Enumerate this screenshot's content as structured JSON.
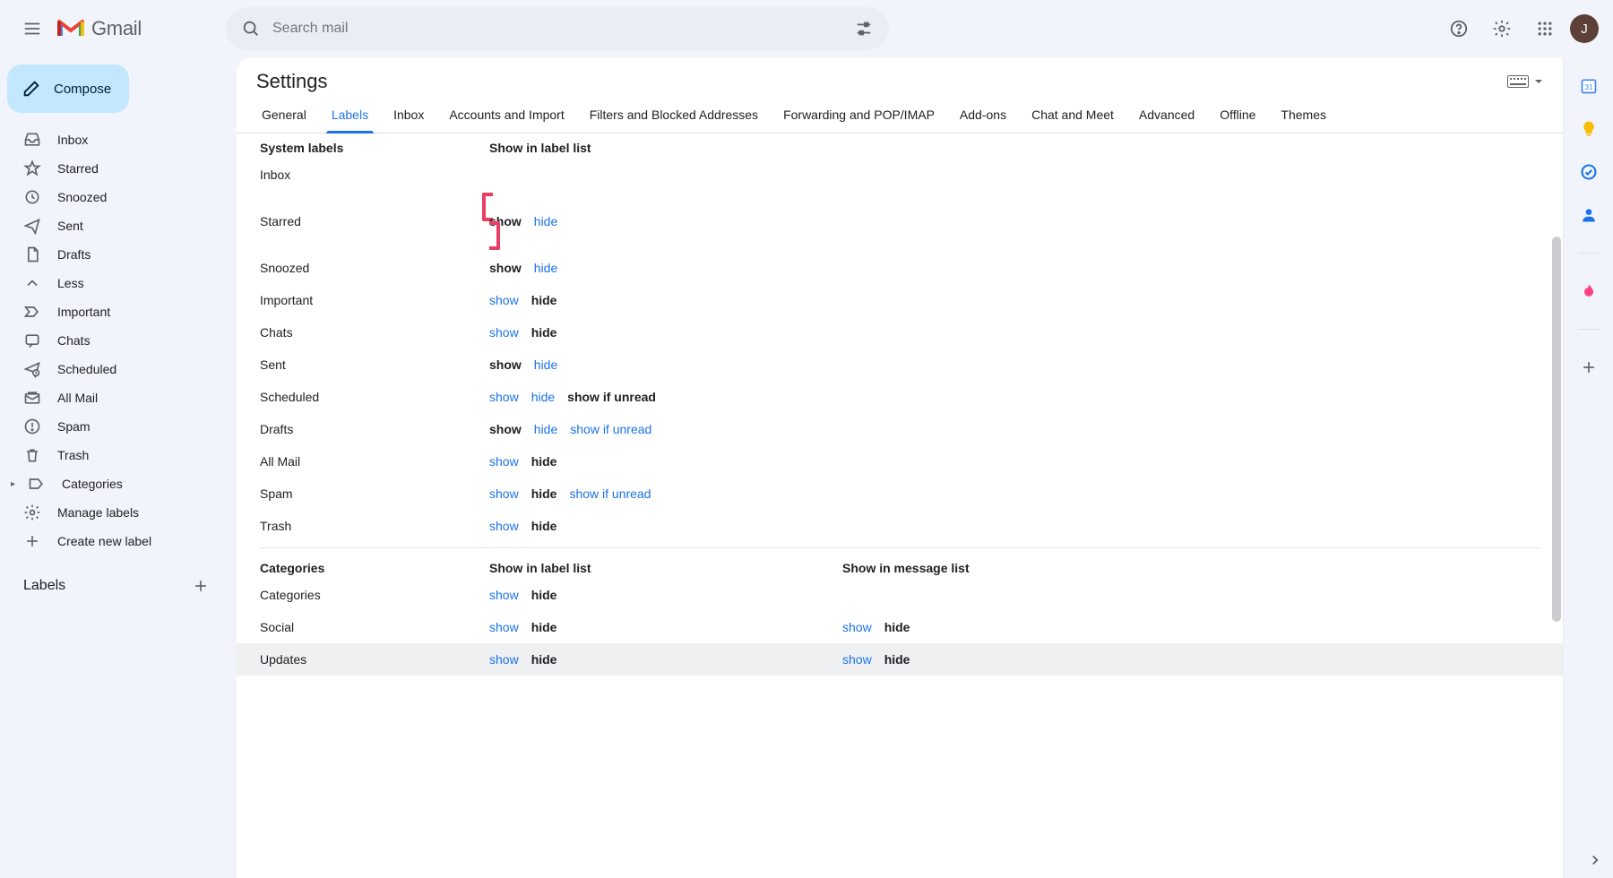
{
  "app_name": "Gmail",
  "search_placeholder": "Search mail",
  "avatar_letter": "J",
  "compose_label": "Compose",
  "sidebar": {
    "items": [
      {
        "label": "Inbox",
        "icon": "inbox-icon"
      },
      {
        "label": "Starred",
        "icon": "star-icon"
      },
      {
        "label": "Snoozed",
        "icon": "clock-icon"
      },
      {
        "label": "Sent",
        "icon": "send-icon"
      },
      {
        "label": "Drafts",
        "icon": "file-icon"
      },
      {
        "label": "Less",
        "icon": "chevron-up-icon"
      },
      {
        "label": "Important",
        "icon": "important-icon"
      },
      {
        "label": "Chats",
        "icon": "chat-icon"
      },
      {
        "label": "Scheduled",
        "icon": "scheduled-icon"
      },
      {
        "label": "All Mail",
        "icon": "allmail-icon"
      },
      {
        "label": "Spam",
        "icon": "spam-icon"
      },
      {
        "label": "Trash",
        "icon": "trash-icon"
      },
      {
        "label": "Categories",
        "icon": "tag-icon"
      },
      {
        "label": "Manage labels",
        "icon": "gear-icon"
      },
      {
        "label": "Create new label",
        "icon": "plus-icon"
      }
    ],
    "labels_heading": "Labels"
  },
  "settings": {
    "title": "Settings",
    "tabs": [
      "General",
      "Labels",
      "Inbox",
      "Accounts and Import",
      "Filters and Blocked Addresses",
      "Forwarding and POP/IMAP",
      "Add-ons",
      "Chat and Meet",
      "Advanced",
      "Offline",
      "Themes"
    ],
    "active_tab": "Labels",
    "section1": {
      "heading": "System labels",
      "col_heading": "Show in label list",
      "rows": [
        {
          "name": "Inbox",
          "opts": []
        },
        {
          "name": "Starred",
          "opts": [
            {
              "t": "show",
              "on": true
            },
            {
              "t": "hide",
              "on": false
            }
          ],
          "highlight": true
        },
        {
          "name": "Snoozed",
          "opts": [
            {
              "t": "show",
              "on": true
            },
            {
              "t": "hide",
              "on": false
            }
          ]
        },
        {
          "name": "Important",
          "opts": [
            {
              "t": "show",
              "on": false
            },
            {
              "t": "hide",
              "on": true
            }
          ]
        },
        {
          "name": "Chats",
          "opts": [
            {
              "t": "show",
              "on": false
            },
            {
              "t": "hide",
              "on": true
            }
          ]
        },
        {
          "name": "Sent",
          "opts": [
            {
              "t": "show",
              "on": true
            },
            {
              "t": "hide",
              "on": false
            }
          ]
        },
        {
          "name": "Scheduled",
          "opts": [
            {
              "t": "show",
              "on": false
            },
            {
              "t": "hide",
              "on": false
            },
            {
              "t": "show if unread",
              "on": true
            }
          ]
        },
        {
          "name": "Drafts",
          "opts": [
            {
              "t": "show",
              "on": true
            },
            {
              "t": "hide",
              "on": false
            },
            {
              "t": "show if unread",
              "on": false
            }
          ]
        },
        {
          "name": "All Mail",
          "opts": [
            {
              "t": "show",
              "on": false
            },
            {
              "t": "hide",
              "on": true
            }
          ]
        },
        {
          "name": "Spam",
          "opts": [
            {
              "t": "show",
              "on": false
            },
            {
              "t": "hide",
              "on": true
            },
            {
              "t": "show if unread",
              "on": false
            }
          ]
        },
        {
          "name": "Trash",
          "opts": [
            {
              "t": "show",
              "on": false
            },
            {
              "t": "hide",
              "on": true
            }
          ]
        }
      ]
    },
    "section2": {
      "heading": "Categories",
      "col1_heading": "Show in label list",
      "col2_heading": "Show in message list",
      "rows": [
        {
          "name": "Categories",
          "opts1": [
            {
              "t": "show",
              "on": false
            },
            {
              "t": "hide",
              "on": true
            }
          ],
          "opts2": []
        },
        {
          "name": "Social",
          "opts1": [
            {
              "t": "show",
              "on": false
            },
            {
              "t": "hide",
              "on": true
            }
          ],
          "opts2": [
            {
              "t": "show",
              "on": false
            },
            {
              "t": "hide",
              "on": true
            }
          ]
        },
        {
          "name": "Updates",
          "opts1": [
            {
              "t": "show",
              "on": false
            },
            {
              "t": "hide",
              "on": true
            }
          ],
          "opts2": [
            {
              "t": "show",
              "on": false
            },
            {
              "t": "hide",
              "on": true
            }
          ],
          "hovered": true
        }
      ]
    }
  }
}
